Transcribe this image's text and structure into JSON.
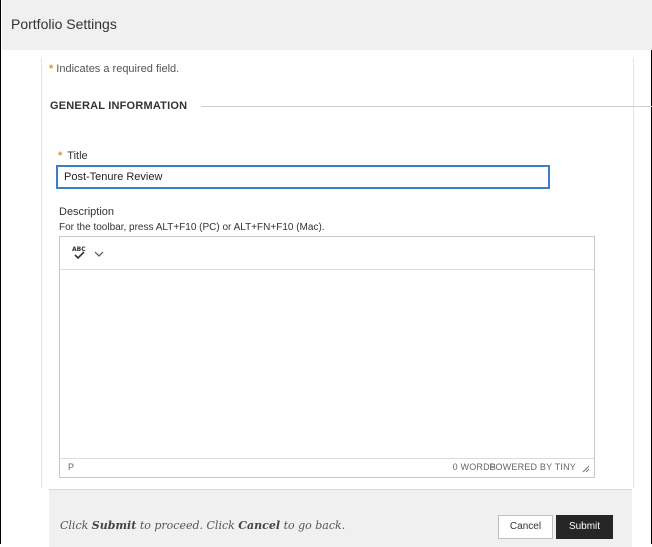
{
  "window": {
    "title": "Portfolio Settings"
  },
  "form": {
    "required_note": "Indicates a required field.",
    "section_title": "GENERAL INFORMATION",
    "title_field": {
      "label": "Title",
      "value": "Post-Tenure Review"
    },
    "description": {
      "label": "Description",
      "hint": "For the toolbar, press ALT+F10 (PC) or ALT+FN+F10 (Mac)."
    }
  },
  "editor": {
    "toolbar_icons": [
      "spellcheck-icon",
      "chevron-down-icon"
    ],
    "status": {
      "path": "P",
      "word_count": "0 WORDS",
      "powered_by": "POWERED BY TINY"
    }
  },
  "footer": {
    "msg_prefix": "Click",
    "msg_submit": "Submit",
    "msg_mid": "to proceed. Click",
    "msg_cancel": "Cancel",
    "msg_suffix": "to go back.",
    "cancel_label": "Cancel",
    "submit_label": "Submit"
  },
  "colors": {
    "required_star": "#e58b2a",
    "focus_border": "#3d7ec9",
    "submit_bg": "#262626",
    "title_bar_bg": "#f0f0f0"
  }
}
